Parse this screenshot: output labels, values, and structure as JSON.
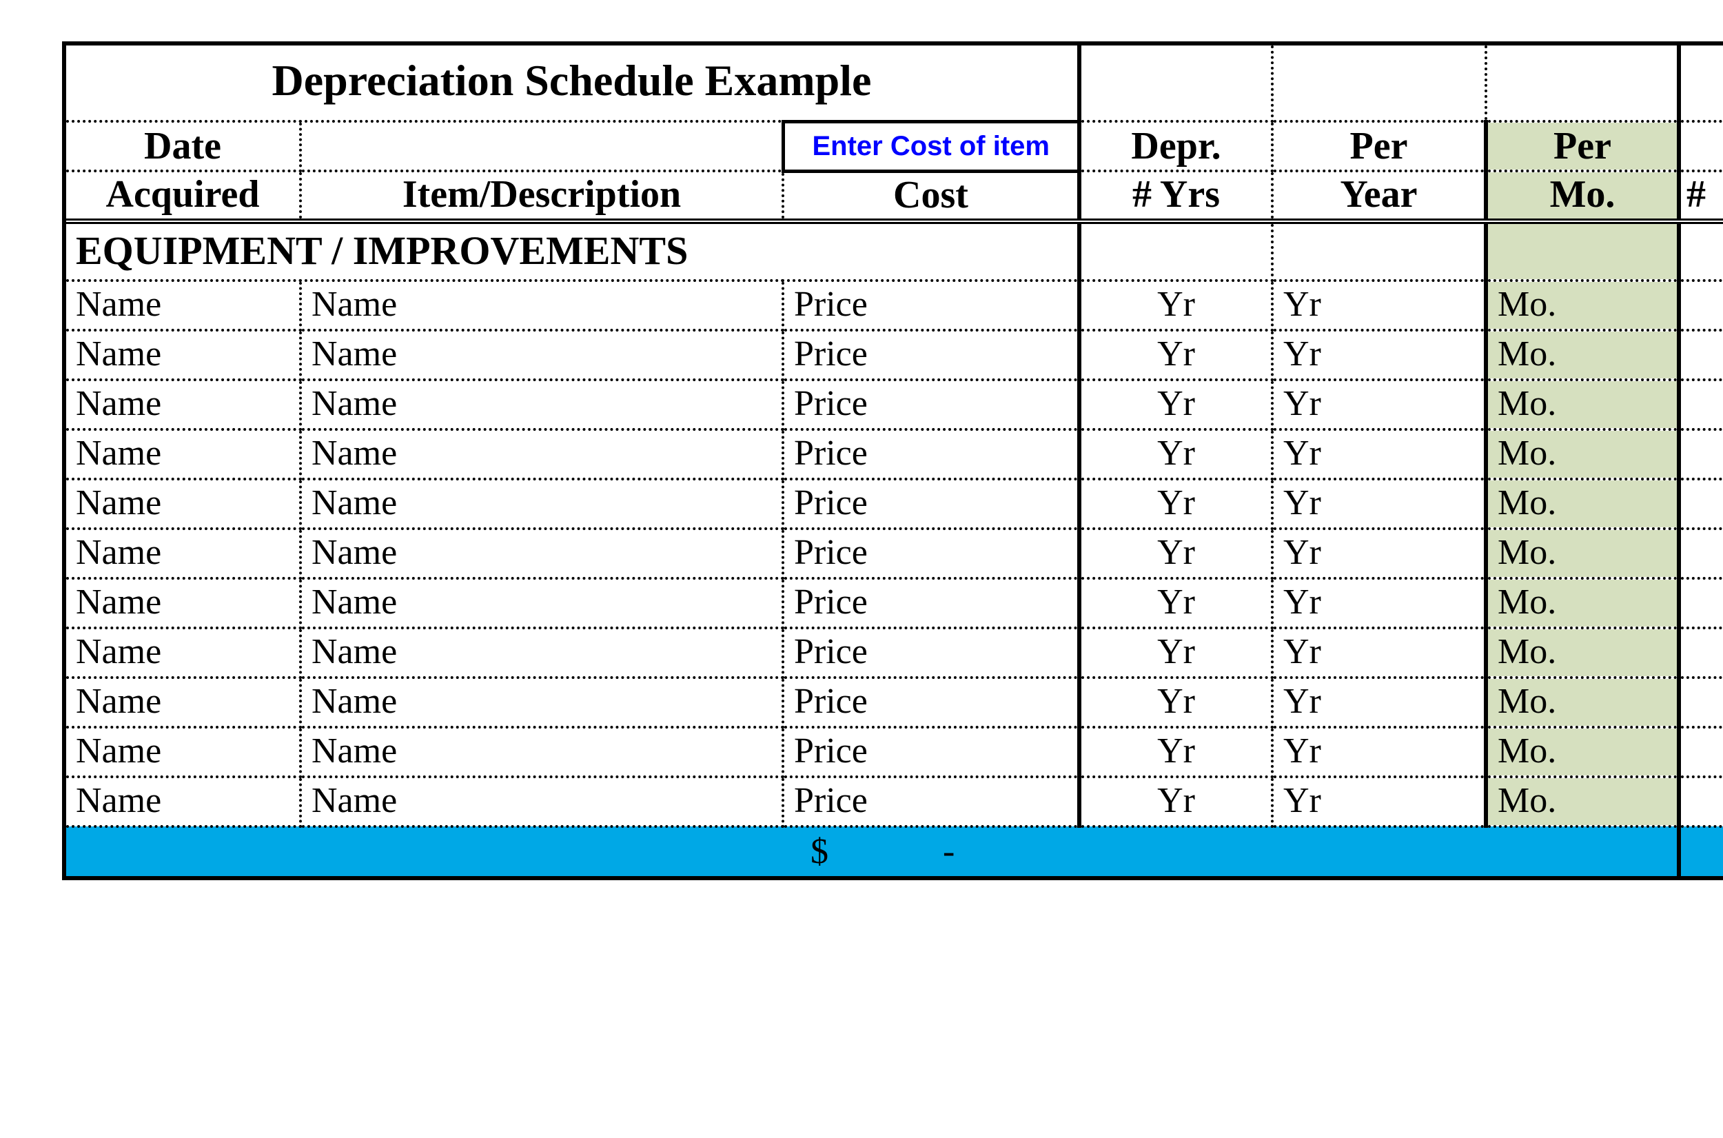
{
  "title": "Depreciation Schedule Example",
  "note": "Enter Cost of item",
  "headers": {
    "date1": "Date",
    "date2": "Acquired",
    "desc": "Item/Description",
    "cost": "Cost",
    "depr1": "Depr.",
    "depr2": "# Yrs",
    "perYear1": "Per",
    "perYear2": "Year",
    "perMo1": "Per",
    "perMo2": "Mo.",
    "tail": "#"
  },
  "section": "EQUIPMENT / IMPROVEMENTS",
  "rows": [
    {
      "date": "Name",
      "desc": "Name",
      "cost": "Price",
      "depr": "Yr",
      "perYear": "Yr",
      "perMo": "Mo."
    },
    {
      "date": "Name",
      "desc": "Name",
      "cost": "Price",
      "depr": "Yr",
      "perYear": "Yr",
      "perMo": "Mo."
    },
    {
      "date": "Name",
      "desc": "Name",
      "cost": "Price",
      "depr": "Yr",
      "perYear": "Yr",
      "perMo": "Mo."
    },
    {
      "date": "Name",
      "desc": "Name",
      "cost": "Price",
      "depr": "Yr",
      "perYear": "Yr",
      "perMo": "Mo."
    },
    {
      "date": "Name",
      "desc": "Name",
      "cost": "Price",
      "depr": "Yr",
      "perYear": "Yr",
      "perMo": "Mo."
    },
    {
      "date": "Name",
      "desc": "Name",
      "cost": "Price",
      "depr": "Yr",
      "perYear": "Yr",
      "perMo": "Mo."
    },
    {
      "date": "Name",
      "desc": "Name",
      "cost": "Price",
      "depr": "Yr",
      "perYear": "Yr",
      "perMo": "Mo."
    },
    {
      "date": "Name",
      "desc": "Name",
      "cost": "Price",
      "depr": "Yr",
      "perYear": "Yr",
      "perMo": "Mo."
    },
    {
      "date": "Name",
      "desc": "Name",
      "cost": "Price",
      "depr": "Yr",
      "perYear": "Yr",
      "perMo": "Mo."
    },
    {
      "date": "Name",
      "desc": "Name",
      "cost": "Price",
      "depr": "Yr",
      "perYear": "Yr",
      "perMo": "Mo."
    },
    {
      "date": "Name",
      "desc": "Name",
      "cost": "Price",
      "depr": "Yr",
      "perYear": "Yr",
      "perMo": "Mo."
    }
  ],
  "totals": {
    "costSymbol": "$",
    "costValue": "-"
  }
}
